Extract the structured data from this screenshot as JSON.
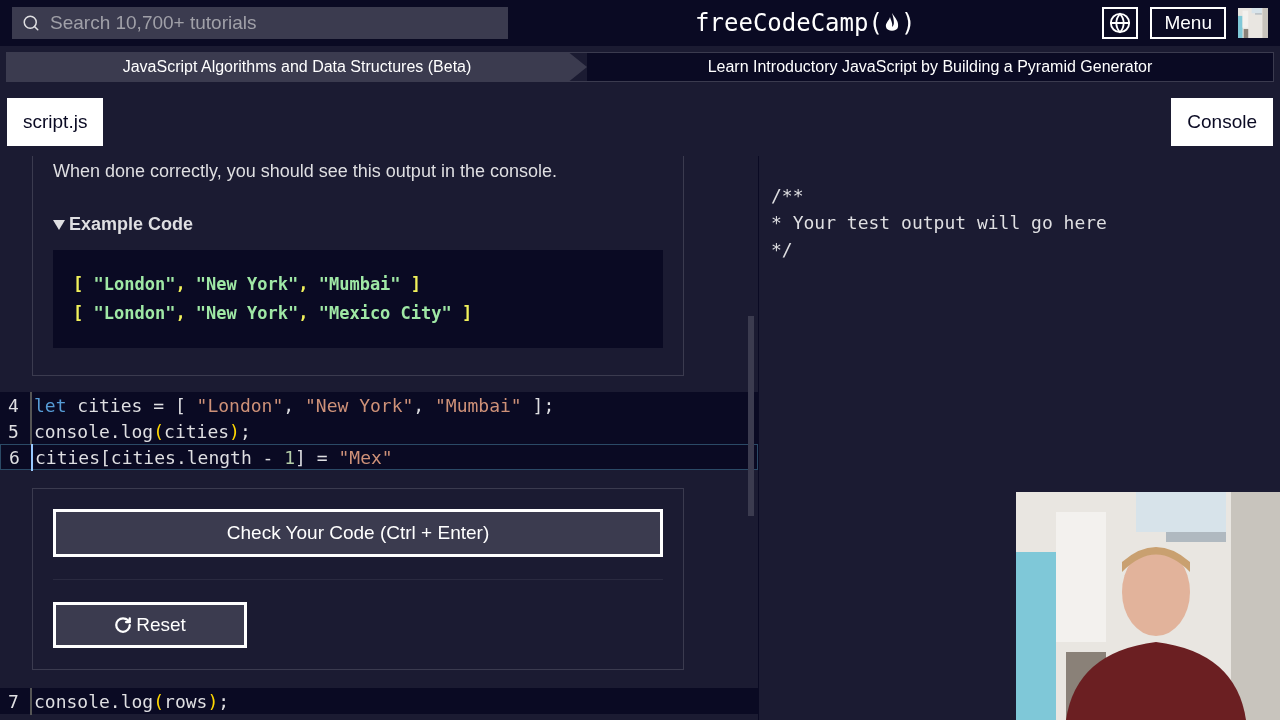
{
  "header": {
    "search": {
      "placeholder": "Search 10,700+ tutorials"
    },
    "logo": "freeCodeCamp(",
    "logo_end": ")",
    "menu": "Menu"
  },
  "breadcrumb": [
    {
      "label": "JavaScript Algorithms and Data Structures (Beta)",
      "selected": true
    },
    {
      "label": "Learn Introductory JavaScript by Building a Pyramid Generator",
      "selected": false
    }
  ],
  "tabs": [
    {
      "label": "script.js"
    },
    {
      "label": "Console"
    }
  ],
  "instructions": {
    "text": "When done correctly, you should see this output in the console.",
    "details": {
      "title": "Example Code",
      "expanded": true,
      "lines": [
        [
          {
            "kind": "bracket",
            "text": "[ "
          },
          {
            "kind": "string",
            "text": "\"London\""
          },
          {
            "kind": "bracket",
            "text": ", "
          },
          {
            "kind": "string",
            "text": "\"New York\""
          },
          {
            "kind": "bracket",
            "text": ", "
          },
          {
            "kind": "string",
            "text": "\"Mumbai\""
          },
          {
            "kind": "bracket",
            "text": " ]"
          }
        ],
        [
          {
            "kind": "bracket",
            "text": "[ "
          },
          {
            "kind": "string",
            "text": "\"London\""
          },
          {
            "kind": "bracket",
            "text": ", "
          },
          {
            "kind": "string",
            "text": "\"New York\""
          },
          {
            "kind": "bracket",
            "text": ", "
          },
          {
            "kind": "string",
            "text": "\"Mexico City\""
          },
          {
            "kind": "bracket",
            "text": " ]"
          }
        ]
      ]
    }
  },
  "editor_lines": [
    {
      "number": "4",
      "tokens": [
        {
          "kind": "keyword",
          "text": "let"
        },
        {
          "kind": "plain",
          "text": " cities = [ "
        },
        {
          "kind": "string",
          "text": "\"London\""
        },
        {
          "kind": "plain",
          "text": ", "
        },
        {
          "kind": "string",
          "text": "\"New York\""
        },
        {
          "kind": "plain",
          "text": ", "
        },
        {
          "kind": "string",
          "text": "\"Mumbai\""
        },
        {
          "kind": "plain",
          "text": " ];"
        }
      ],
      "selected": false
    },
    {
      "number": "5",
      "tokens": [
        {
          "kind": "plain",
          "text": "console.log"
        },
        {
          "kind": "bracket",
          "text": "("
        },
        {
          "kind": "plain",
          "text": "cities"
        },
        {
          "kind": "bracket",
          "text": ")"
        },
        {
          "kind": "plain",
          "text": ";"
        }
      ],
      "selected": false
    },
    {
      "number": "6",
      "tokens": [
        {
          "kind": "plain",
          "text": "cities[cities.length - "
        },
        {
          "kind": "number",
          "text": "1"
        },
        {
          "kind": "plain",
          "text": "] = "
        },
        {
          "kind": "string",
          "text": "\"Mex\""
        }
      ],
      "selected": true
    }
  ],
  "buttons": {
    "check": "Check Your Code (Ctrl + Enter)",
    "reset": "Reset"
  },
  "editor_lines_after": [
    {
      "number": "7",
      "tokens": [
        {
          "kind": "plain",
          "text": "console.log"
        },
        {
          "kind": "bracket",
          "text": "("
        },
        {
          "kind": "plain",
          "text": "rows"
        },
        {
          "kind": "bracket",
          "text": ")"
        },
        {
          "kind": "plain",
          "text": ";"
        }
      ],
      "selected": false
    }
  ],
  "console": {
    "lines": [
      "/**",
      "* Your test output will go here",
      "*/"
    ]
  }
}
